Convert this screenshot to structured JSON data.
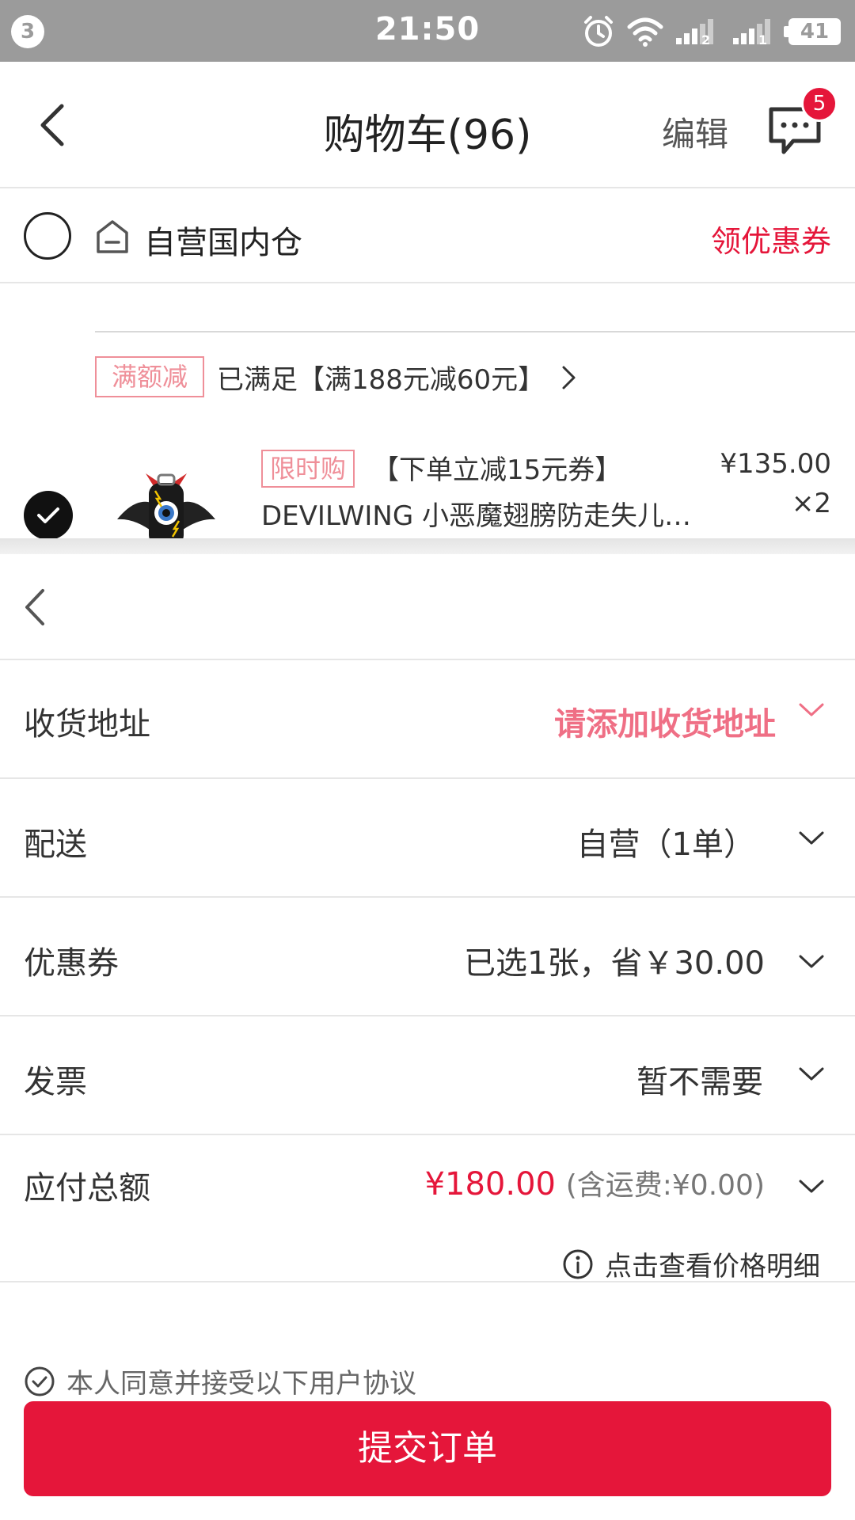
{
  "status_bar": {
    "notification_count": "3",
    "time": "21:50",
    "battery": "41",
    "sim1": "2",
    "sim2": "1"
  },
  "cart": {
    "title": "购物车(96)",
    "edit_label": "编辑",
    "message_badge": "5",
    "store_name": "自营国内仓",
    "coupon_link": "领优惠券",
    "promo_tag": "满额减",
    "promo_text": "已满足【满188元减60元】",
    "item": {
      "tag": "限时购",
      "tag_text": "【下单立减15元券】",
      "name": "DEVILWING 小恶魔翅膀防走失儿…",
      "price": "¥135.00",
      "qty": "×2"
    }
  },
  "order": {
    "address_label": "收货地址",
    "address_value": "请添加收货地址",
    "delivery_label": "配送",
    "delivery_value": "自营（1单）",
    "coupon_label": "优惠券",
    "coupon_value": "已选1张，省￥30.00",
    "invoice_label": "发票",
    "invoice_value": "暂不需要",
    "total_label": "应付总额",
    "total_amount": "¥180.00",
    "total_shipping": "(含运费:¥0.00)",
    "price_detail": "点击查看价格明细",
    "agreement": "本人同意并接受以下用户协议",
    "submit": "提交订单"
  },
  "colors": {
    "accent": "#e5163a",
    "accent_light": "#ef8f99",
    "status_bar": "#9b9b9b"
  },
  "icons": [
    "back-icon",
    "chat-icon",
    "store-icon",
    "chevron-down-icon",
    "info-icon",
    "check-circle-icon",
    "alarm-icon",
    "wifi-icon",
    "signal-icon",
    "battery-icon"
  ]
}
